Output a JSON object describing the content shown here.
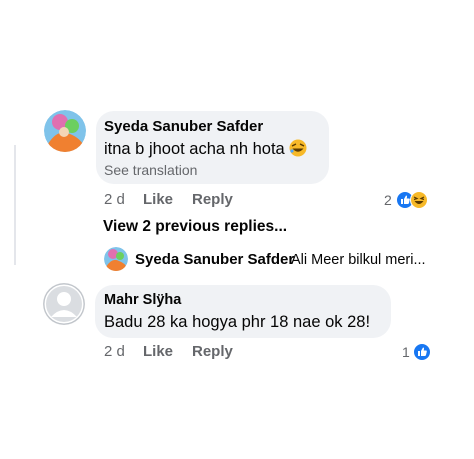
{
  "comment1": {
    "author": "Syeda Sanuber Safder",
    "text": "itna b jhoot acha nh hota",
    "text_emoji": "rolling-laughing-emoji",
    "see_translation": "See translation",
    "time": "2 d",
    "like_label": "Like",
    "reply_label": "Reply",
    "reaction_count": "2",
    "reactions": [
      "like",
      "haha"
    ]
  },
  "replies": {
    "view_previous": "View 2 previous replies...",
    "latest_reply_author": "Syeda Sanuber Safder",
    "latest_reply_preview": "Ali Meer bilkul meri..."
  },
  "comment2": {
    "author": "Mahr Slÿha",
    "text": "Badu 28 ka hogya phr 18 nae ok 28!",
    "time": "2 d",
    "like_label": "Like",
    "reply_label": "Reply",
    "reaction_count": "1",
    "reactions": [
      "like"
    ]
  },
  "colors": {
    "bubble": "#f0f2f5",
    "secondary_text": "#65676b",
    "like_blue": "#1877f2",
    "haha_yellow": "#f7b928"
  }
}
